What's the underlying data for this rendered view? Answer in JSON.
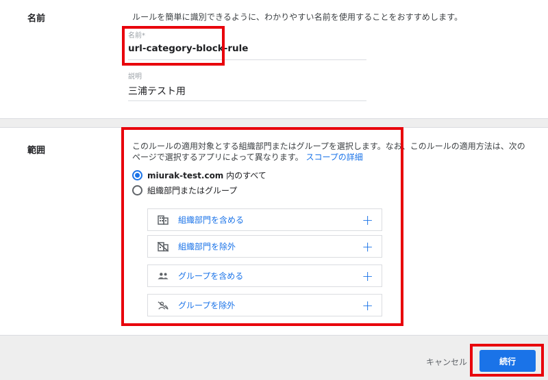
{
  "name_section": {
    "label": "名前",
    "hint": "ルールを簡単に識別できるように、わかりやすい名前を使用することをおすすめします。",
    "name_field": {
      "label": "名前*",
      "value": "url-category-block-rule"
    },
    "description_field": {
      "label": "説明",
      "value": "三浦テスト用"
    }
  },
  "scope_section": {
    "label": "範囲",
    "description_line1": "このルールの適用対象とする組織部門またはグループを選択します。なお、このルールの適用方法は、次の",
    "description_line2": "ページで選択するアプリによって異なります。",
    "details_link": "スコープの詳細",
    "radio_options": [
      {
        "bold": "miurak-test.com",
        "text": " 内のすべて",
        "checked": true
      },
      {
        "bold": "",
        "text": "組織部門またはグループ",
        "checked": false
      }
    ],
    "actions": [
      {
        "label": "組織部門を含める",
        "icon": "building-icon"
      },
      {
        "label": "組織部門を除外",
        "icon": "building-off-icon"
      },
      {
        "label": "グループを含める",
        "icon": "group-icon"
      },
      {
        "label": "グループを除外",
        "icon": "group-off-icon"
      }
    ],
    "plus_glyph": "+"
  },
  "footer": {
    "cancel_label": "キャンセル",
    "continue_label": "続行"
  },
  "colors": {
    "accent": "#1a73e8",
    "highlight": "#e8000b"
  }
}
